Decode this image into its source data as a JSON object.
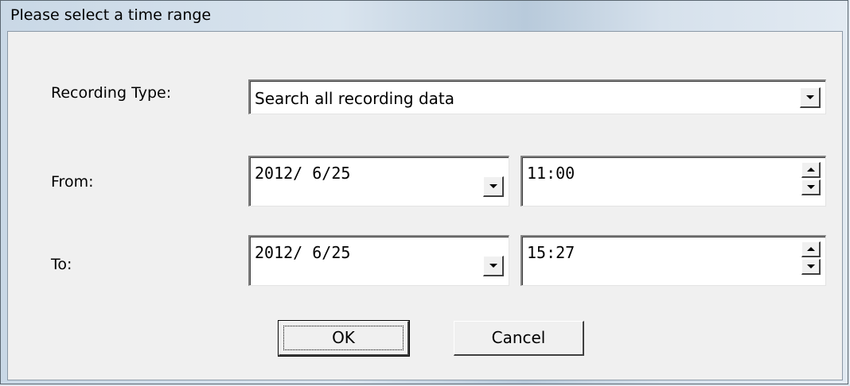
{
  "window": {
    "title": "Please select a time range"
  },
  "recording_type": {
    "label": "Recording Type:",
    "selected": "Search all recording data"
  },
  "from": {
    "label": "From:",
    "date": "2012/  6/25",
    "time": "11:00"
  },
  "to": {
    "label": "To:",
    "date": "2012/  6/25",
    "time": "15:27"
  },
  "buttons": {
    "ok": "OK",
    "cancel": "Cancel"
  },
  "icons": {
    "dropdown": "chevron-down-icon",
    "spin_up": "arrow-up-icon",
    "spin_down": "arrow-down-icon"
  }
}
